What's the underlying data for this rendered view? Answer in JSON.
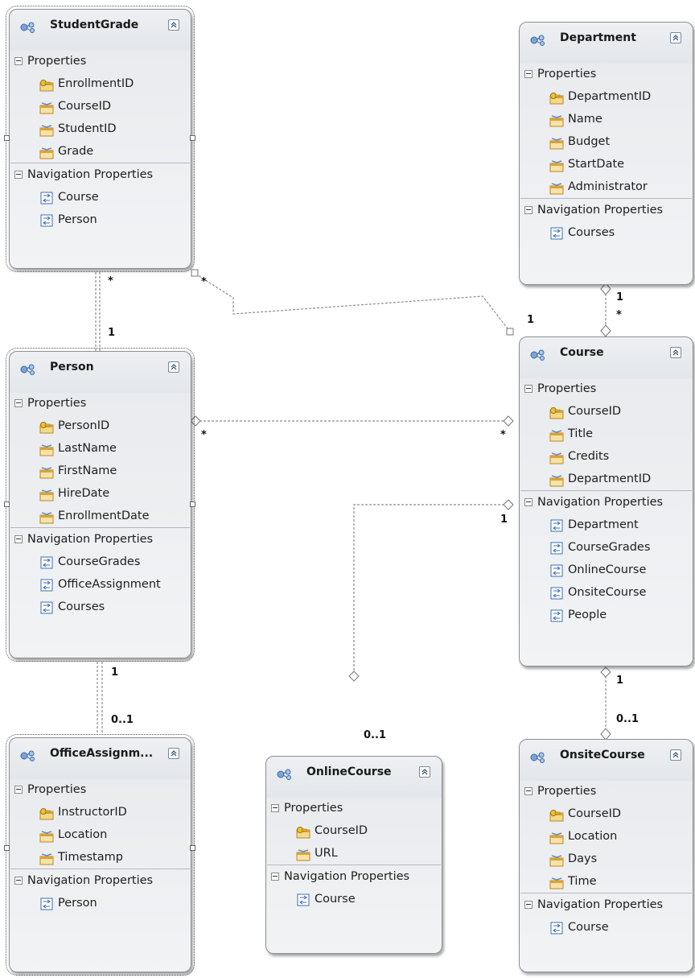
{
  "entities": {
    "student_grade": {
      "title": "StudentGrade",
      "sections": {
        "properties": "Properties",
        "navigation": "Navigation Properties"
      },
      "properties": [
        "EnrollmentID",
        "CourseID",
        "StudentID",
        "Grade"
      ],
      "key": "EnrollmentID",
      "navigation": [
        "Course",
        "Person"
      ]
    },
    "department": {
      "title": "Department",
      "sections": {
        "properties": "Properties",
        "navigation": "Navigation Properties"
      },
      "properties": [
        "DepartmentID",
        "Name",
        "Budget",
        "StartDate",
        "Administrator"
      ],
      "key": "DepartmentID",
      "navigation": [
        "Courses"
      ]
    },
    "person": {
      "title": "Person",
      "sections": {
        "properties": "Properties",
        "navigation": "Navigation Properties"
      },
      "properties": [
        "PersonID",
        "LastName",
        "FirstName",
        "HireDate",
        "EnrollmentDate"
      ],
      "key": "PersonID",
      "navigation": [
        "CourseGrades",
        "OfficeAssignment",
        "Courses"
      ]
    },
    "course": {
      "title": "Course",
      "sections": {
        "properties": "Properties",
        "navigation": "Navigation Properties"
      },
      "properties": [
        "CourseID",
        "Title",
        "Credits",
        "DepartmentID"
      ],
      "key": "CourseID",
      "navigation": [
        "Department",
        "CourseGrades",
        "OnlineCourse",
        "OnsiteCourse",
        "People"
      ]
    },
    "office_assignment": {
      "title": "OfficeAssignm...",
      "sections": {
        "properties": "Properties",
        "navigation": "Navigation Properties"
      },
      "properties": [
        "InstructorID",
        "Location",
        "Timestamp"
      ],
      "key": "InstructorID",
      "navigation": [
        "Person"
      ]
    },
    "online_course": {
      "title": "OnlineCourse",
      "sections": {
        "properties": "Properties",
        "navigation": "Navigation Properties"
      },
      "properties": [
        "CourseID",
        "URL"
      ],
      "key": "CourseID",
      "navigation": [
        "Course"
      ]
    },
    "onsite_course": {
      "title": "OnsiteCourse",
      "sections": {
        "properties": "Properties",
        "navigation": "Navigation Properties"
      },
      "properties": [
        "CourseID",
        "Location",
        "Days",
        "Time"
      ],
      "key": "CourseID",
      "navigation": [
        "Course"
      ]
    }
  },
  "multiplicities": {
    "studentgrade_person_top": "*",
    "studentgrade_person_bottom": "1",
    "studentgrade_course_start": "*",
    "studentgrade_course_end": "1",
    "department_course_top": "1",
    "department_course_bottom": "*",
    "person_course_left": "*",
    "person_course_right": "*",
    "course_online_top": "1",
    "course_online_bottom": "0..1",
    "person_office_top": "1",
    "person_office_bottom": "0..1",
    "course_onsite_top": "1",
    "course_onsite_bottom": "0..1"
  },
  "colors": {
    "entity_border": "#8b8f95",
    "connector": "#8c8c8c",
    "key_icon": "#e8b83a",
    "property_icon": "#d9a23b",
    "nav_icon": "#3d6fb5"
  }
}
